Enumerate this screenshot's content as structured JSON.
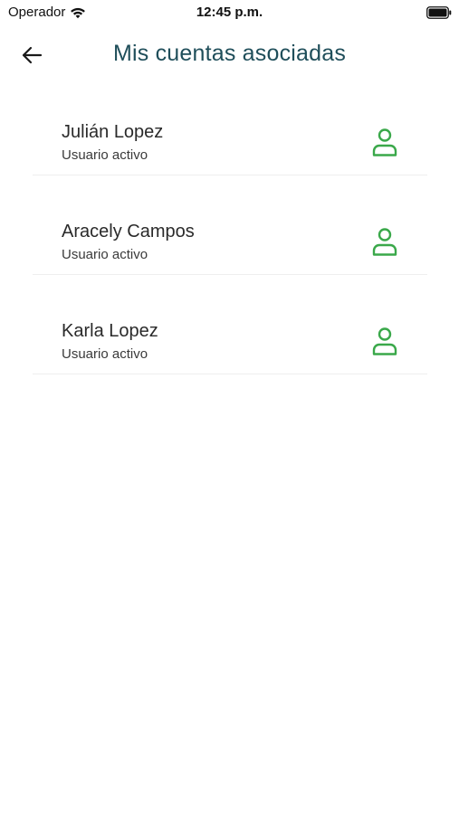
{
  "status_bar": {
    "carrier": "Operador",
    "time": "12:45 p.m."
  },
  "header": {
    "title": "Mis cuentas asociadas"
  },
  "accounts": [
    {
      "name": "Julián Lopez",
      "status": "Usuario activo"
    },
    {
      "name": "Aracely Campos",
      "status": "Usuario activo"
    },
    {
      "name": "Karla Lopez",
      "status": "Usuario activo"
    }
  ],
  "icons": {
    "back": "arrow-left-icon",
    "account": "user-icon",
    "wifi": "wifi-icon",
    "battery": "battery-icon"
  },
  "colors": {
    "title": "#1f4e5a",
    "accent_green": "#3aa84a",
    "divider": "#eeeeee"
  }
}
